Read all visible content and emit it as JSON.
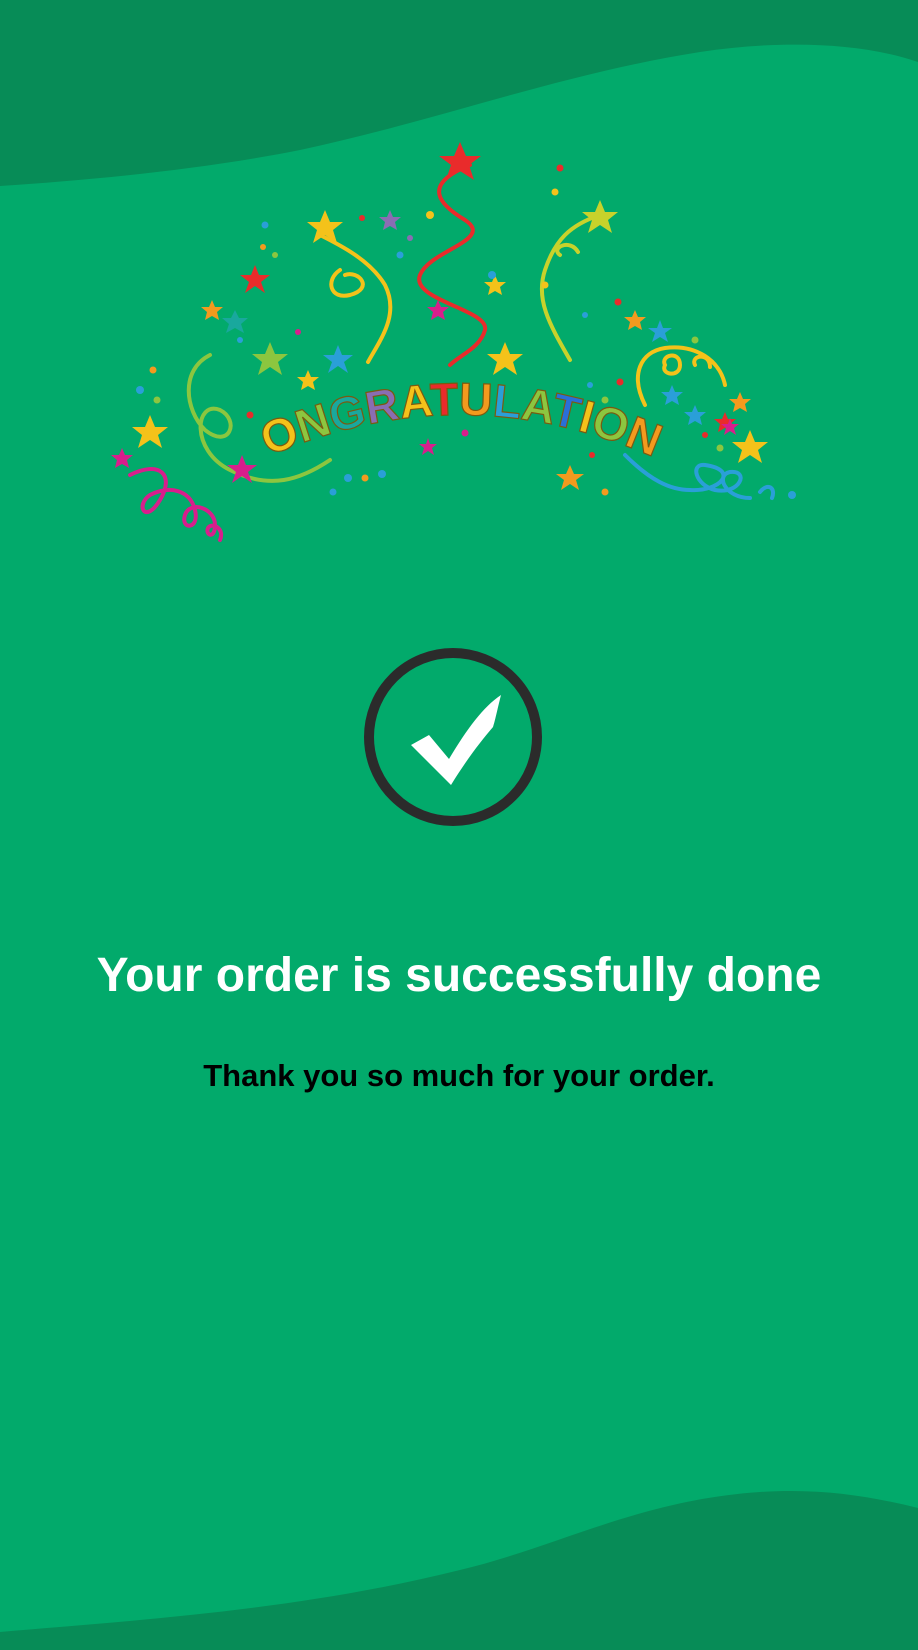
{
  "colors": {
    "background": "#02aa6b",
    "wave": "#078c57",
    "check_ring": "#2b2b2b",
    "check_mark": "#ffffff",
    "title": "#ffffff",
    "subtitle": "#000000"
  },
  "banner": {
    "text": "CONGRATULATIONS",
    "letter_colors": [
      "#f39a1e",
      "#f4c21a",
      "#8cc63f",
      "#19a89d",
      "#8a6db3",
      "#f4c21a",
      "#e92b2b",
      "#f39a1e",
      "#2a9fd8",
      "#8cc63f",
      "#2a6fd8",
      "#f4c21a",
      "#8cc63f",
      "#f39a1e",
      "#e92b2b"
    ]
  },
  "success_icon": "check-circle-icon",
  "message": {
    "title": "Your order is successfully done",
    "subtitle": "Thank you so much for your order."
  }
}
